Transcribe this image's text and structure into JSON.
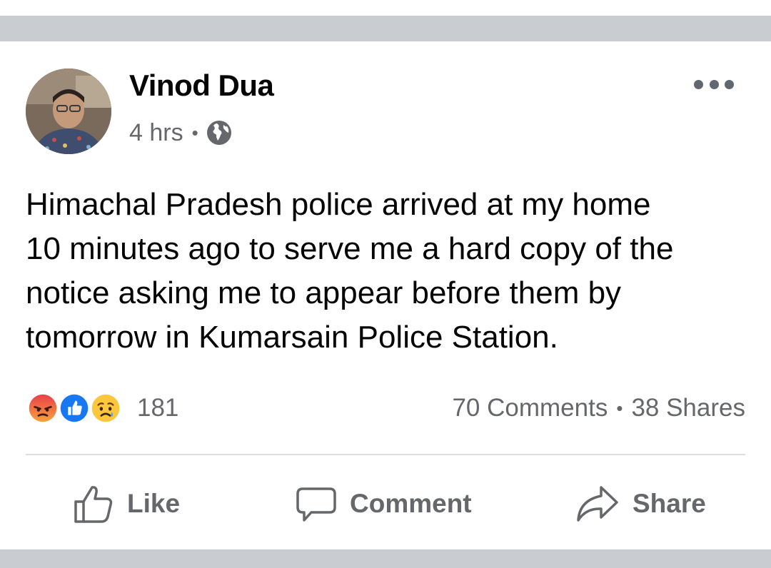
{
  "post": {
    "author": "Vinod Dua",
    "time": "4 hrs",
    "separator": "•",
    "privacy_icon": "globe-icon",
    "text_lines": [
      "Himachal Pradesh police arrived at my home",
      "10 minutes ago to serve me a hard copy of the",
      "notice asking me to appear before them by",
      "tomorrow in Kumarsain Police Station."
    ]
  },
  "stats": {
    "reactions": [
      "angry",
      "like",
      "sad"
    ],
    "reaction_count": "181",
    "comments": "70 Comments",
    "separator": "•",
    "shares": "38 Shares"
  },
  "actions": {
    "like_label": "Like",
    "comment_label": "Comment",
    "share_label": "Share"
  },
  "colors": {
    "divider": "#dadde1",
    "secondary_text": "#65676b",
    "band": "#c9ccd1",
    "like_blue": "#1877f2",
    "angry_orange": "#f0692e",
    "sad_yellow": "#fcc73c"
  }
}
